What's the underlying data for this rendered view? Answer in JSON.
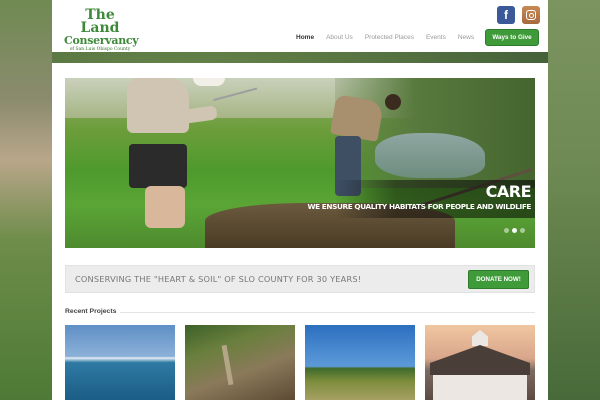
{
  "header": {
    "logo": {
      "line1": "The Land",
      "line2": "Conservancy",
      "line3": "of San Luis Obispo County"
    },
    "social": {
      "facebook_icon": "facebook-icon",
      "instagram_icon": "instagram-icon",
      "facebook_glyph": "f"
    },
    "nav": [
      {
        "label": "Home",
        "active": true
      },
      {
        "label": "About Us",
        "active": false
      },
      {
        "label": "Protected Places",
        "active": false
      },
      {
        "label": "Events",
        "active": false
      },
      {
        "label": "News",
        "active": false
      }
    ],
    "ways_to_give_label": "Ways to Give"
  },
  "hero": {
    "title": "CARE",
    "subtitle": "WE ENSURE QUALITY HABITATS FOR PEOPLE AND WILDLIFE",
    "slide_dots": 3,
    "active_dot": 1
  },
  "banner": {
    "text": "CONSERVING THE \"HEART & SOIL\" OF SLO COUNTY FOR 30 YEARS!",
    "donate_label": "DONATE NOW!"
  },
  "recent_projects": {
    "title": "Recent Projects",
    "thumbnails": [
      "coastline-photo",
      "fence-brush-photo",
      "meadow-photo",
      "barn-photo"
    ]
  },
  "colors": {
    "brand_green": "#3f9a3a",
    "facebook_blue": "#3b5998"
  }
}
